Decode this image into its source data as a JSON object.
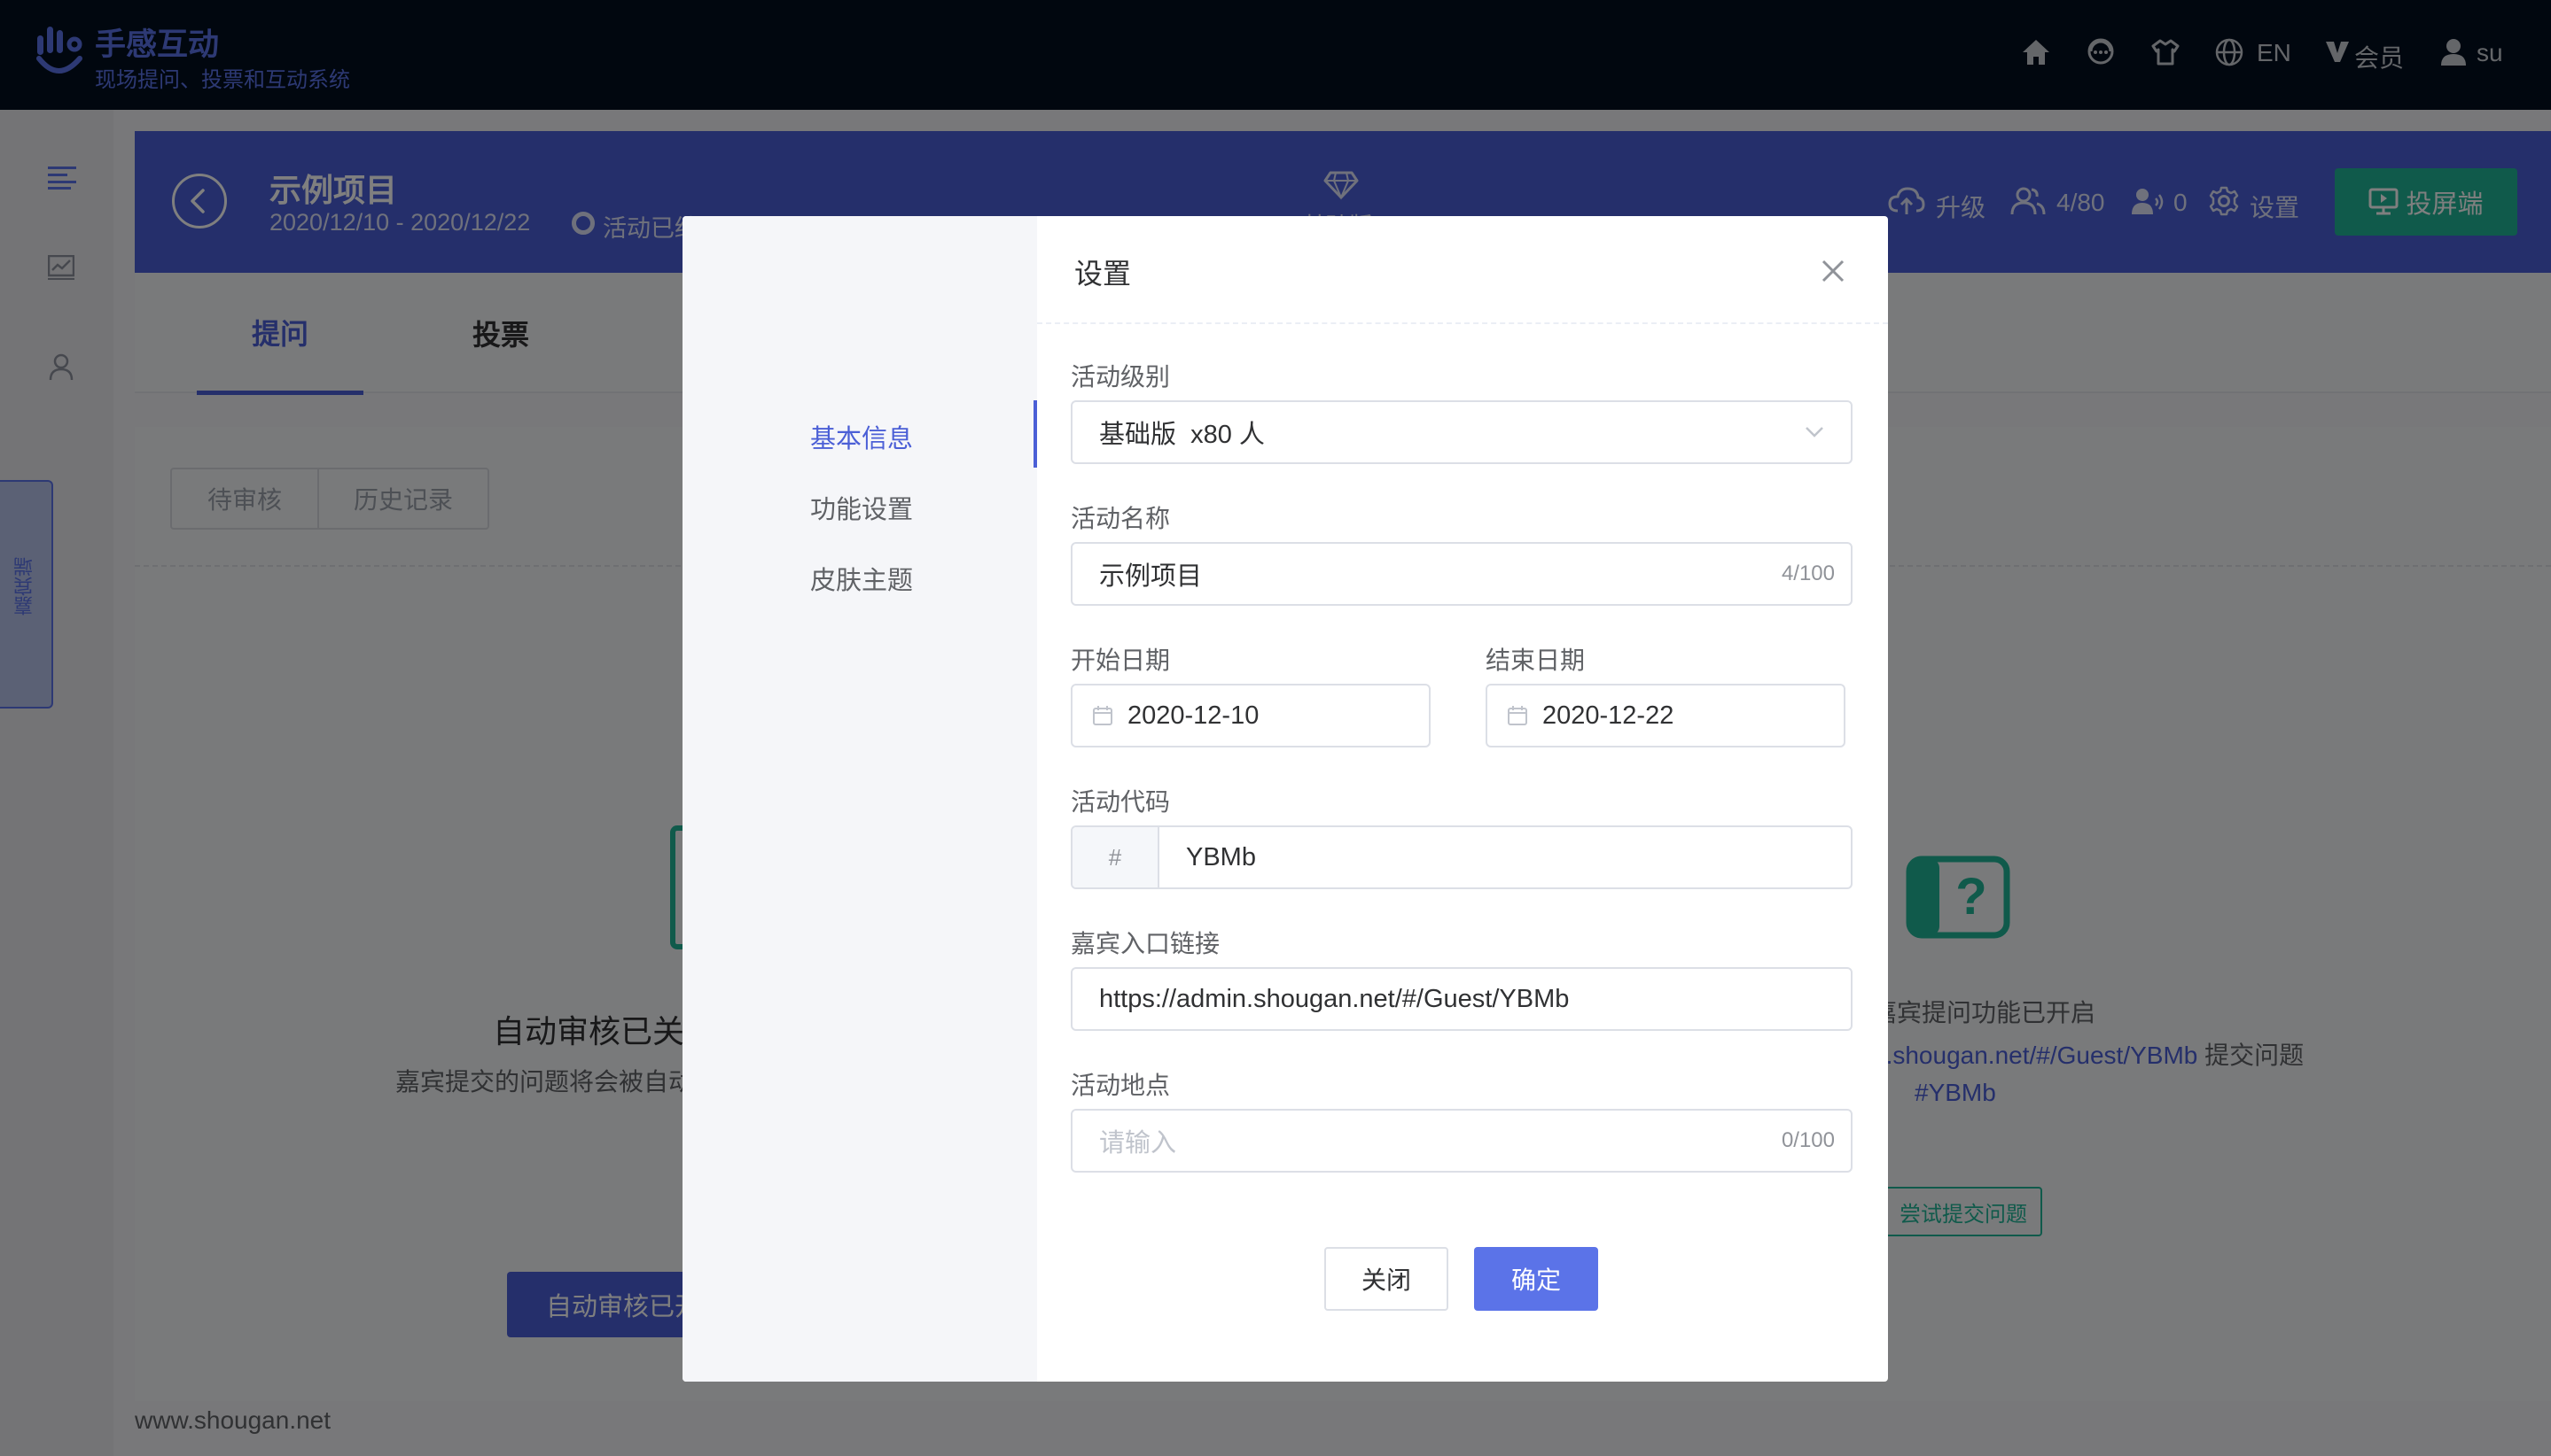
{
  "colors": {
    "brand": "#5b73e8",
    "header_bg": "#4b5fd6",
    "accent_green": "#21b496",
    "topbar_bg": "#030f1f"
  },
  "topbar": {
    "brand_title": "手感互动",
    "brand_subtitle": "现场提问、投票和互动系统",
    "icons": [
      "home-icon",
      "chat-icon",
      "shirt-icon",
      "globe-icon",
      "vip-icon",
      "user-icon"
    ],
    "lang_label": "EN",
    "vip_label": "会员",
    "user_label": "su"
  },
  "sidebar": {
    "icons": [
      "list-icon",
      "chart-icon",
      "person-icon"
    ],
    "guest_tab_label": "嘉宾端"
  },
  "project": {
    "title": "示例项目",
    "dates": "2020/12/10 - 2020/12/22",
    "status": "活动已结束",
    "plan": "基础版",
    "upgrade_label": "升级",
    "attendees": "4/80",
    "online": "0",
    "settings_label": "设置",
    "screen_button": "投屏端"
  },
  "tabs": [
    {
      "label": "提问"
    },
    {
      "label": "投票"
    }
  ],
  "content": {
    "seg_pending": "待审核",
    "seg_history": "历史记录",
    "auto_title": "自动审核已关闭",
    "auto_desc": "嘉宾提交的问题将会被自动…",
    "auto_button": "自动审核已开启",
    "right_title": "嘉宾提问功能已开启",
    "right_link": "n.shougan.net/#/Guest/YBMb",
    "right_link_tail": " 提交问题",
    "right_code": "#YBMb",
    "try_button": "尝试提交问题"
  },
  "footer": {
    "url": "www.shougan.net"
  },
  "modal": {
    "title": "设置",
    "nav": [
      {
        "label": "基本信息"
      },
      {
        "label": "功能设置"
      },
      {
        "label": "皮肤主题"
      }
    ],
    "nav_active_index": 0,
    "level_label": "活动级别",
    "level_value": "基础版  x80 人",
    "name_label": "活动名称",
    "name_value": "示例项目",
    "name_count": "4/100",
    "start_label": "开始日期",
    "start_value": "2020-12-10",
    "end_label": "结束日期",
    "end_value": "2020-12-22",
    "code_label": "活动代码",
    "code_prefix": "#",
    "code_value": "YBMb",
    "link_label": "嘉宾入口链接",
    "link_value": "https://admin.shougan.net/#/Guest/YBMb",
    "place_label": "活动地点",
    "place_placeholder": "请输入",
    "place_count": "0/100",
    "close_button": "关闭",
    "ok_button": "确定"
  }
}
